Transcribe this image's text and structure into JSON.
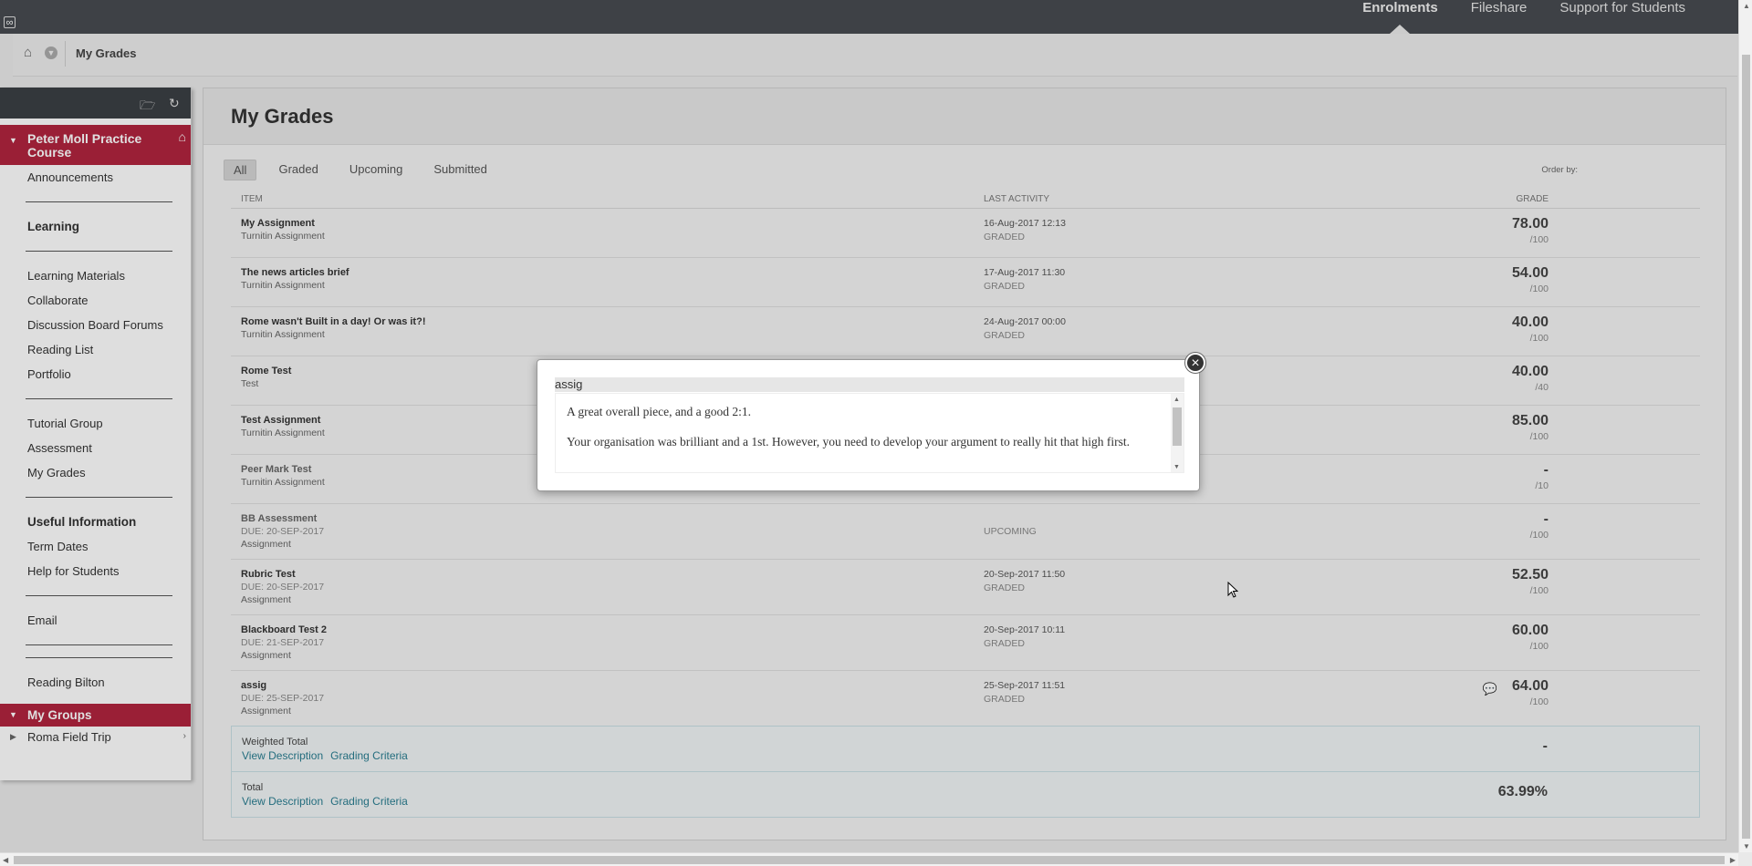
{
  "topnav": {
    "tabs": [
      "Enrolments",
      "Fileshare",
      "Support for Students"
    ],
    "active": "Enrolments"
  },
  "breadcrumb": {
    "current": "My Grades"
  },
  "sidebar": {
    "course_title": "Peter Moll Practice Course",
    "sections": [
      {
        "items": [
          {
            "label": "Announcements",
            "head": false
          }
        ]
      },
      {
        "items": [
          {
            "label": "Learning",
            "head": true
          }
        ]
      },
      {
        "items": [
          {
            "label": "Learning Materials",
            "head": false
          },
          {
            "label": "Collaborate",
            "head": false
          },
          {
            "label": "Discussion Board Forums",
            "head": false
          },
          {
            "label": "Reading List",
            "head": false
          },
          {
            "label": "Portfolio",
            "head": false
          }
        ]
      },
      {
        "items": [
          {
            "label": "Tutorial Group",
            "head": false
          },
          {
            "label": "Assessment",
            "head": false
          },
          {
            "label": "My Grades",
            "head": false
          }
        ]
      },
      {
        "items": [
          {
            "label": "Useful Information",
            "head": true
          },
          {
            "label": "Term Dates",
            "head": false
          },
          {
            "label": "Help for Students",
            "head": false
          }
        ]
      },
      {
        "items": [
          {
            "label": "Email",
            "head": false
          }
        ]
      },
      {
        "items": []
      },
      {
        "items": [
          {
            "label": "Reading Bilton",
            "head": false
          }
        ]
      }
    ],
    "groups_title": "My Groups",
    "group_item": "Roma Field Trip"
  },
  "main": {
    "title": "My Grades",
    "filters": [
      "All",
      "Graded",
      "Upcoming",
      "Submitted"
    ],
    "active_filter": "All",
    "order_by": "Order by:",
    "columns": {
      "item": "ITEM",
      "last_activity": "LAST ACTIVITY",
      "grade": "GRADE"
    },
    "rows": [
      {
        "name": "My Assignment",
        "due": "",
        "type": "Turnitin Assignment",
        "date": "16-Aug-2017 12:13",
        "status": "GRADED",
        "grade": "78.00",
        "points": "/100",
        "comment": false,
        "dim": false
      },
      {
        "name": "The news articles brief",
        "due": "",
        "type": "Turnitin Assignment",
        "date": "17-Aug-2017 11:30",
        "status": "GRADED",
        "grade": "54.00",
        "points": "/100",
        "comment": false,
        "dim": false
      },
      {
        "name": "Rome wasn't Built in a day! Or was it?!",
        "due": "",
        "type": "Turnitin Assignment",
        "date": "24-Aug-2017 00:00",
        "status": "GRADED",
        "grade": "40.00",
        "points": "/100",
        "comment": false,
        "dim": false
      },
      {
        "name": "Rome Test",
        "due": "",
        "type": "Test",
        "date": "",
        "status": "",
        "grade": "40.00",
        "points": "/40",
        "comment": false,
        "dim": false
      },
      {
        "name": "Test Assignment",
        "due": "",
        "type": "Turnitin Assignment",
        "date": "",
        "status": "",
        "grade": "85.00",
        "points": "/100",
        "comment": false,
        "dim": false
      },
      {
        "name": "Peer Mark Test",
        "due": "",
        "type": "Turnitin Assignment",
        "date": "",
        "status": "",
        "grade": "-",
        "points": "/10",
        "comment": false,
        "dim": true
      },
      {
        "name": "BB Assessment",
        "due": "DUE: 20-SEP-2017",
        "type": "Assignment",
        "date": "",
        "status": "UPCOMING",
        "grade": "-",
        "points": "/100",
        "comment": false,
        "dim": true
      },
      {
        "name": "Rubric Test",
        "due": "DUE: 20-SEP-2017",
        "type": "Assignment",
        "date": "20-Sep-2017 11:50",
        "status": "GRADED",
        "grade": "52.50",
        "points": "/100",
        "comment": false,
        "dim": false
      },
      {
        "name": "Blackboard Test 2",
        "due": "DUE: 21-SEP-2017",
        "type": "Assignment",
        "date": "20-Sep-2017 10:11",
        "status": "GRADED",
        "grade": "60.00",
        "points": "/100",
        "comment": false,
        "dim": false
      },
      {
        "name": "assig",
        "due": "DUE: 25-SEP-2017",
        "type": "Assignment",
        "date": "25-Sep-2017 11:51",
        "status": "GRADED",
        "grade": "64.00",
        "points": "/100",
        "comment": true,
        "dim": false
      }
    ],
    "totals": [
      {
        "name": "Weighted Total",
        "link1": "View Description",
        "link2": "Grading Criteria",
        "value": "-"
      },
      {
        "name": "Total",
        "link1": "View Description",
        "link2": "Grading Criteria",
        "value": "63.99%"
      }
    ]
  },
  "modal": {
    "title": "assig",
    "paragraphs": [
      "A great overall piece, and a good 2:1.",
      "Your organisation was brilliant and a 1st.  However, you need to develop your argument to really hit that high first."
    ]
  }
}
